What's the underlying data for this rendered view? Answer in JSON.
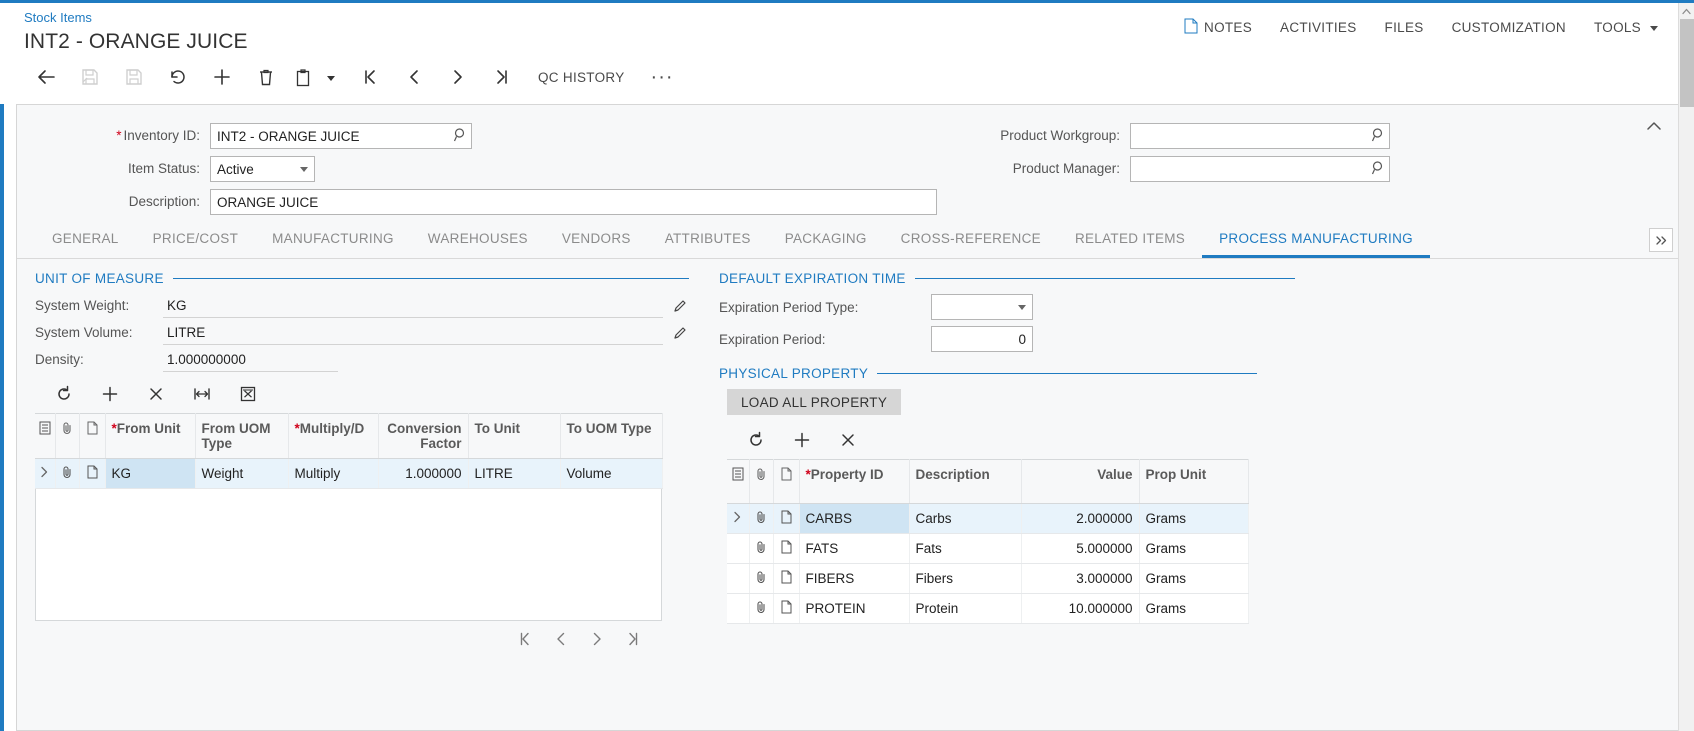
{
  "header": {
    "breadcrumb": "Stock Items",
    "title": "INT2 - ORANGE JUICE",
    "menu": [
      {
        "label": "NOTES",
        "icon": "note-icon"
      },
      {
        "label": "ACTIVITIES",
        "icon": ""
      },
      {
        "label": "FILES",
        "icon": ""
      },
      {
        "label": "CUSTOMIZATION",
        "icon": ""
      },
      {
        "label": "TOOLS",
        "icon": "chevron-down-icon"
      }
    ]
  },
  "toolbar": {
    "back_label": "back",
    "save_label": "save",
    "save_close_label": "save-and-close",
    "undo_label": "undo",
    "add_label": "add-new-record",
    "delete_label": "delete-record",
    "copy_label": "copy-paste",
    "first_label": "first-record",
    "prev_label": "previous-record",
    "next_label": "next-record",
    "last_label": "last-record",
    "qc_history": "QC HISTORY",
    "more": "···"
  },
  "summary": {
    "inventory_id": {
      "label": "Inventory ID:",
      "required": true,
      "value": "INT2 - ORANGE JUICE"
    },
    "item_status": {
      "label": "Item Status:",
      "value": "Active"
    },
    "description": {
      "label": "Description:",
      "value": "ORANGE JUICE"
    },
    "product_workgroup": {
      "label": "Product Workgroup:",
      "value": ""
    },
    "product_manager": {
      "label": "Product Manager:",
      "value": ""
    }
  },
  "tabs": [
    {
      "label": "GENERAL",
      "active": false
    },
    {
      "label": "PRICE/COST",
      "active": false
    },
    {
      "label": "MANUFACTURING",
      "active": false
    },
    {
      "label": "WAREHOUSES",
      "active": false
    },
    {
      "label": "VENDORS",
      "active": false
    },
    {
      "label": "ATTRIBUTES",
      "active": false
    },
    {
      "label": "PACKAGING",
      "active": false
    },
    {
      "label": "CROSS-REFERENCE",
      "active": false
    },
    {
      "label": "RELATED ITEMS",
      "active": false
    },
    {
      "label": "PROCESS MANUFACTURING",
      "active": true
    }
  ],
  "unit_of_measure": {
    "section_title": "UNIT OF MEASURE",
    "system_weight": {
      "label": "System Weight:",
      "value": "KG"
    },
    "system_volume": {
      "label": "System Volume:",
      "value": "LITRE"
    },
    "density": {
      "label": "Density:",
      "value": "1.000000000"
    },
    "grid_toolbar": {
      "refresh": "refresh-icon",
      "add": "plus-icon",
      "delete": "close-icon",
      "fit": "fit-columns-icon",
      "export": "export-excel-icon"
    },
    "columns": [
      {
        "key": "from_unit",
        "label": "From Unit",
        "required": true,
        "align": "left"
      },
      {
        "key": "from_uom_type",
        "label": "From UOM Type",
        "required": false,
        "align": "left"
      },
      {
        "key": "multiply_d",
        "label": "Multiply/D",
        "required": true,
        "align": "left"
      },
      {
        "key": "conversion_factor",
        "label": "Conversion Factor",
        "required": false,
        "align": "right"
      },
      {
        "key": "to_unit",
        "label": "To Unit",
        "required": false,
        "align": "left"
      },
      {
        "key": "to_uom_type",
        "label": "To UOM Type",
        "required": false,
        "align": "left"
      }
    ],
    "rows": [
      {
        "selected": true,
        "from_unit": "KG",
        "from_uom_type": "Weight",
        "multiply_d": "Multiply",
        "conversion_factor": "1.000000",
        "to_unit": "LITRE",
        "to_uom_type": "Volume"
      }
    ],
    "pager": {
      "first": "first-page-icon",
      "prev": "previous-page-icon",
      "next": "next-page-icon",
      "last": "last-page-icon"
    }
  },
  "default_expiration_time": {
    "section_title": "DEFAULT EXPIRATION TIME",
    "expiration_period_type": {
      "label": "Expiration Period Type:",
      "value": ""
    },
    "expiration_period": {
      "label": "Expiration Period:",
      "value": "0"
    }
  },
  "physical_property": {
    "section_title": "PHYSICAL PROPERTY",
    "load_all_button": "LOAD ALL PROPERTY",
    "grid_toolbar": {
      "refresh": "refresh-icon",
      "add": "plus-icon",
      "delete": "close-icon"
    },
    "columns": [
      {
        "key": "property_id",
        "label": "Property ID",
        "required": true,
        "align": "left"
      },
      {
        "key": "description",
        "label": "Description",
        "required": false,
        "align": "left"
      },
      {
        "key": "value",
        "label": "Value",
        "required": false,
        "align": "right"
      },
      {
        "key": "prop_unit",
        "label": "Prop Unit",
        "required": false,
        "align": "left"
      }
    ],
    "rows": [
      {
        "selected": true,
        "property_id": "CARBS",
        "description": "Carbs",
        "value": "2.000000",
        "prop_unit": "Grams"
      },
      {
        "selected": false,
        "property_id": "FATS",
        "description": "Fats",
        "value": "5.000000",
        "prop_unit": "Grams"
      },
      {
        "selected": false,
        "property_id": "FIBERS",
        "description": "Fibers",
        "value": "3.000000",
        "prop_unit": "Grams"
      },
      {
        "selected": false,
        "property_id": "PROTEIN",
        "description": "Protein",
        "value": "10.000000",
        "prop_unit": "Grams"
      }
    ]
  },
  "colors": {
    "accent": "#1f7bc1",
    "required": "#d0021b",
    "panel_bg": "#f7f8f9",
    "selected_row": "#e8f3fb",
    "selected_cell": "#cfe4f3",
    "button_grey": "#d6d6d6"
  }
}
